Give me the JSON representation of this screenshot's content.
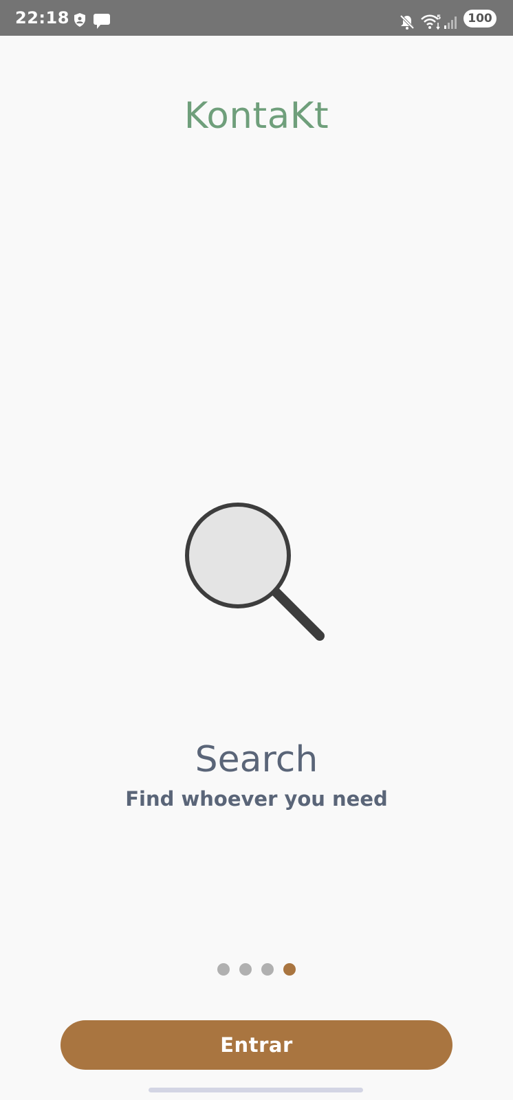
{
  "status_bar": {
    "time": "22:18",
    "battery": "100",
    "background": "#747474",
    "icons": [
      "shield-icon",
      "message-icon",
      "mute-icon",
      "wifi-icon",
      "signal-icon",
      "battery-icon"
    ]
  },
  "app": {
    "title": "KontaKt",
    "title_color": "#6f9f7b",
    "accent_color": "#a97540"
  },
  "onboarding": {
    "illustration": "magnifier-icon",
    "title": "Search",
    "subtitle": "Find whoever you need",
    "page_count": 4,
    "active_page": 4
  },
  "actions": {
    "enter_label": "Entrar"
  }
}
